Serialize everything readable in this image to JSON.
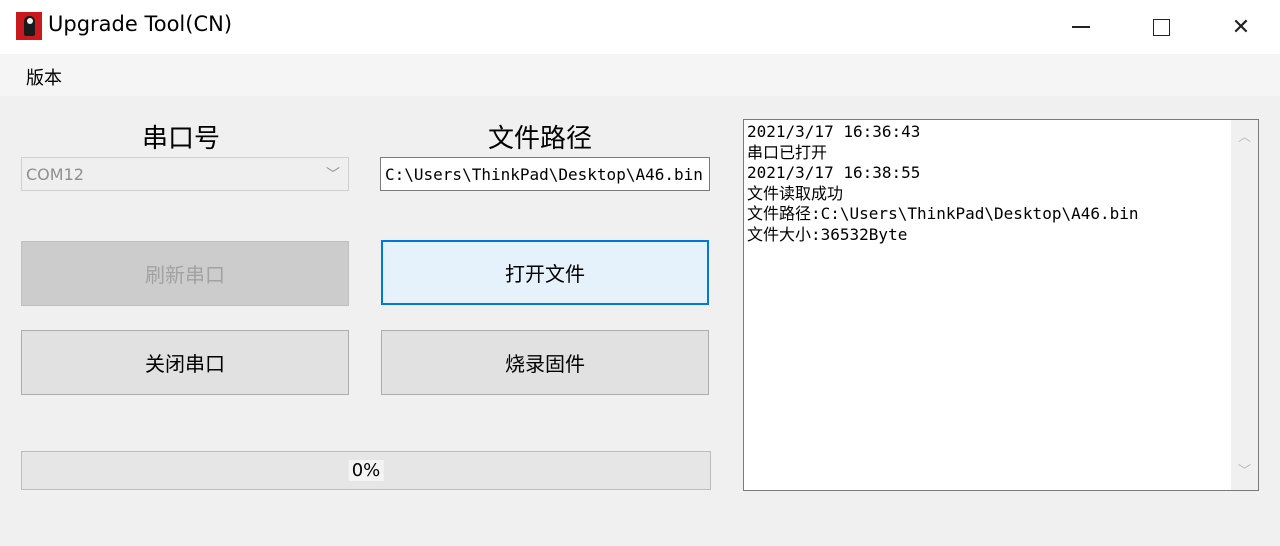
{
  "window": {
    "title": "Upgrade Tool(CN)",
    "icon": "app-logo-icon",
    "controls": {
      "minimize": "minimize-icon",
      "maximize": "maximize-icon",
      "close": "close-icon",
      "close_glyph": "✕"
    }
  },
  "menu": {
    "items": [
      "版本"
    ]
  },
  "serial": {
    "label": "串口号",
    "selected_port": "COM12",
    "dropdown_glyph": "﹀",
    "refresh_button": "刷新串口",
    "close_button": "关闭串口"
  },
  "file": {
    "label": "文件路径",
    "path_value": "C:\\Users\\ThinkPad\\Desktop\\A46.bin",
    "open_button": "打开文件",
    "flash_button": "烧录固件"
  },
  "progress": {
    "value": 0,
    "text": "0%"
  },
  "log": {
    "lines": [
      "2021/3/17 16:36:43",
      "串口已打开",
      "2021/3/17 16:38:55",
      "文件读取成功",
      "文件路径:C:\\Users\\ThinkPad\\Desktop\\A46.bin",
      "文件大小:36532Byte"
    ],
    "scroll_up": "︿",
    "scroll_down": "﹀"
  },
  "colors": {
    "accent": "#0078d7",
    "app_icon_red": "#c9181e",
    "progress_fill": "#06b025"
  }
}
